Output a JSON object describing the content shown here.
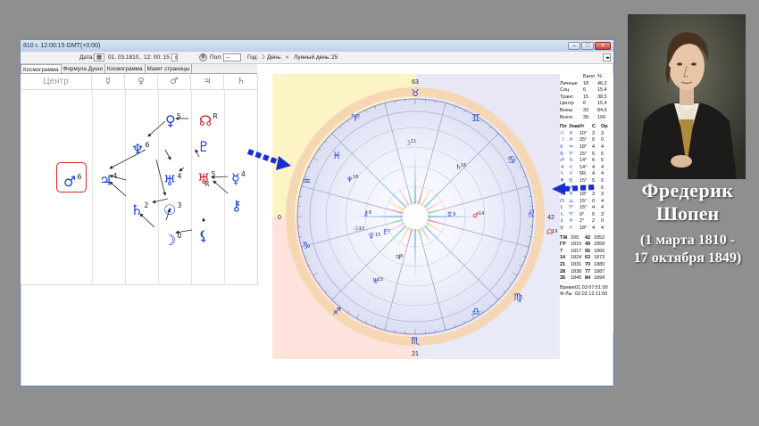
{
  "window": {
    "title": "810 г. 12:00:15 GMT(+0:00)",
    "buttons": [
      "–",
      "□",
      "×"
    ]
  },
  "toolbar": {
    "date_label": "Дата:",
    "date_value": "01. 03.1810",
    "time_value": "12: 00: 15",
    "pol_label": "Пол:",
    "pol_value": "--",
    "year_label": "Год:",
    "day_label": "День:",
    "lunar_label": "Лунный день:",
    "lunar_value": "25"
  },
  "tabs": [
    "Космограмма",
    "Формула Души",
    "Космограмма",
    "Макет страницы"
  ],
  "left_panel": {
    "headers": [
      "Центр",
      "☿",
      "♀",
      "♂",
      "♃",
      "♄"
    ],
    "nodes": [
      {
        "glyph": "♀",
        "num": "5"
      },
      {
        "glyph": "☊",
        "num": "R"
      },
      {
        "glyph": "♆",
        "num": "6"
      },
      {
        "glyph": "♇",
        "num": ""
      },
      {
        "glyph": "♂",
        "num": "6"
      },
      {
        "glyph": "♃",
        "num": "4"
      },
      {
        "glyph": "♅",
        "num": "4"
      },
      {
        "glyph": "♅",
        "num": "5"
      },
      {
        "glyph": "R",
        "num": ""
      },
      {
        "glyph": "☿",
        "num": "4"
      },
      {
        "glyph": "♄",
        "num": "2"
      },
      {
        "glyph": "☉",
        "num": "3"
      },
      {
        "glyph": "⚷",
        "num": ""
      },
      {
        "glyph": "☽",
        "num": "0"
      },
      {
        "glyph": "⚸",
        "num": ""
      }
    ]
  },
  "chart": {
    "outer_labels": [
      "63",
      "42",
      "21",
      "0"
    ],
    "signs": [
      "♈",
      "♉",
      "♊",
      "♋",
      "♌",
      "♍",
      "♎",
      "♏",
      "♐",
      "♑",
      "♒",
      "♓"
    ],
    "planet_labels": [
      {
        "glyph": "♆",
        "deg": "18"
      },
      {
        "glyph": "☽",
        "deg": "11"
      },
      {
        "glyph": "♄",
        "deg": "16"
      },
      {
        "glyph": "☿",
        "deg": "9"
      },
      {
        "glyph": "♂",
        "deg": "14"
      },
      {
        "glyph": "⚷",
        "deg": "6"
      },
      {
        "glyph": "☉",
        "deg": "10"
      },
      {
        "glyph": "♀",
        "deg": "15"
      },
      {
        "glyph": "♇",
        "deg": "7"
      },
      {
        "glyph": "♅",
        "deg": "15"
      },
      {
        "glyph": "♃",
        "deg": "8"
      },
      {
        "glyph": "☊",
        "deg": "19"
      }
    ]
  },
  "table": {
    "head": [
      "Балл",
      "%"
    ],
    "summary": [
      [
        "Личные",
        "18",
        "46,2"
      ],
      [
        "Соц",
        "6",
        "15,4"
      ],
      [
        "Транс",
        "15",
        "38,5"
      ],
      [
        "Центр",
        "6",
        "15,4"
      ],
      [
        "Внеш",
        "33",
        "84,6"
      ],
      [
        "Всего",
        "39",
        "100"
      ]
    ],
    "planet_head": [
      "Пл",
      "Знак",
      "Уг",
      "С",
      "Ор"
    ],
    "planets": [
      [
        "☉",
        "♓",
        "10°",
        "3",
        "3"
      ],
      [
        "☽",
        "♓",
        "25°",
        "0",
        "0"
      ],
      [
        "☿",
        "♒",
        "18°",
        "4",
        "4"
      ],
      [
        "♀",
        "♈",
        "15°",
        "5",
        "5"
      ],
      [
        "♂",
        "♑",
        "14°",
        "6",
        "6"
      ],
      [
        "♃",
        "♌",
        "14°",
        "4",
        "4"
      ],
      [
        "♄",
        "♌",
        "5R",
        "4",
        "4"
      ],
      [
        "♅",
        "♏",
        "15°",
        "5",
        "5"
      ],
      [
        "♆",
        "♐",
        "15°",
        "6",
        "6"
      ],
      [
        "♇",
        "♓",
        "18°",
        "3",
        "3"
      ],
      [
        "☊",
        "♎",
        "15°",
        "0",
        "4"
      ],
      [
        "⚸",
        "♈",
        "15°",
        "4",
        "4"
      ],
      [
        "♄",
        "♈",
        "9°",
        "0",
        "3"
      ],
      [
        "⚷",
        "♓",
        "2°",
        "2",
        "0"
      ],
      [
        "♀",
        "♌",
        "18°",
        "4",
        "4"
      ]
    ],
    "years": [
      [
        "ТЖ",
        "205",
        "42",
        "1852"
      ],
      [
        "ГР",
        "1810",
        "49",
        "1859"
      ],
      [
        "7",
        "1817",
        "56",
        "1866"
      ],
      [
        "14",
        "1824",
        "63",
        "1873"
      ],
      [
        "21",
        "1831",
        "70",
        "1880"
      ],
      [
        "28",
        "1838",
        "77",
        "1887"
      ],
      [
        "35",
        "1845",
        "84",
        "1894"
      ]
    ],
    "time_label": "Время",
    "time_value": "01.03 07:51:00",
    "fl_label": "Ф-Лы",
    "fl_value": "02.03 12:11:00"
  },
  "caption": {
    "name": "Фредерик",
    "surname": "Шопен",
    "dates_line1": "(1 марта 1810 -",
    "dates_line2": "17 октября 1849)"
  },
  "colors": {
    "chart_blue": "#1a3fd8",
    "chart_red": "#d8221e",
    "arrow_blue": "#1b2fd0"
  }
}
